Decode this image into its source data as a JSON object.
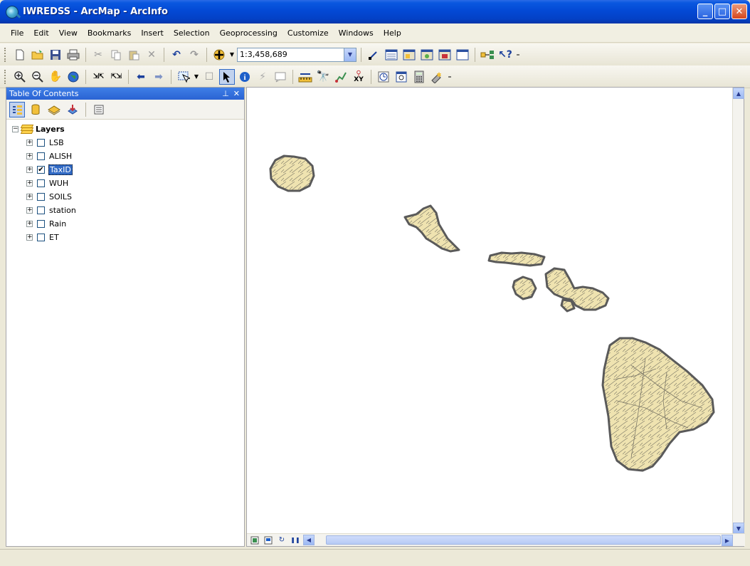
{
  "window": {
    "title": "IWREDSS - ArcMap - ArcInfo",
    "buttons": {
      "minimize": "_",
      "maximize": "□",
      "close": "✕"
    }
  },
  "menu": [
    "File",
    "Edit",
    "View",
    "Bookmarks",
    "Insert",
    "Selection",
    "Geoprocessing",
    "Customize",
    "Windows",
    "Help"
  ],
  "toolbar": {
    "scale": "1:3,458,689",
    "more_glyph": "₌"
  },
  "toc": {
    "title": "Table Of Contents",
    "pin_glyph": "⊥",
    "close_glyph": "✕",
    "root_label": "Layers",
    "root_expander": "−",
    "layers": [
      {
        "label": "LSB",
        "checked": false,
        "selected": false
      },
      {
        "label": "ALISH",
        "checked": false,
        "selected": false
      },
      {
        "label": "TaxID",
        "checked": true,
        "selected": true
      },
      {
        "label": "WUH",
        "checked": false,
        "selected": false
      },
      {
        "label": "SOILS",
        "checked": false,
        "selected": false
      },
      {
        "label": "station",
        "checked": false,
        "selected": false
      },
      {
        "label": "Rain",
        "checked": false,
        "selected": false
      },
      {
        "label": "ET",
        "checked": false,
        "selected": false
      }
    ],
    "child_expander": "+"
  },
  "colors": {
    "island_fill": "#efe3b0",
    "island_boundary": "#5a5a5a",
    "selection_highlight": "#316ac5",
    "title_bar": "#0349d5"
  }
}
